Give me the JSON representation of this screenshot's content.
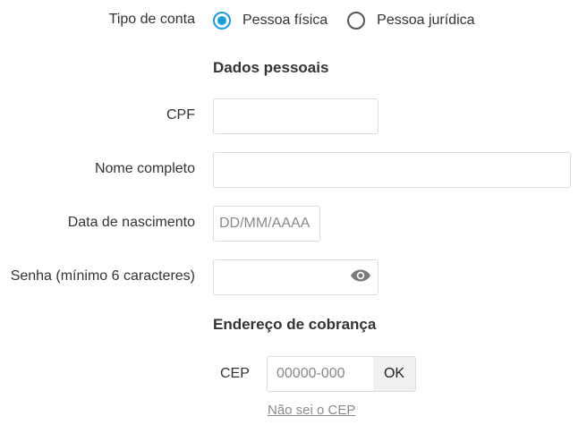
{
  "account_type": {
    "label": "Tipo de conta",
    "options": [
      {
        "label": "Pessoa física",
        "selected": true
      },
      {
        "label": "Pessoa jurídica",
        "selected": false
      }
    ]
  },
  "personal": {
    "section_title": "Dados pessoais",
    "cpf": {
      "label": "CPF",
      "value": "",
      "placeholder": ""
    },
    "full_name": {
      "label": "Nome completo",
      "value": "",
      "placeholder": ""
    },
    "birth_date": {
      "label": "Data de nascimento",
      "value": "",
      "placeholder": "DD/MM/AAAA"
    },
    "password": {
      "label": "Senha (mínimo 6 caracteres)",
      "value": "",
      "placeholder": "",
      "toggle_icon": "eye-icon"
    }
  },
  "billing": {
    "section_title": "Endereço de cobrança",
    "cep": {
      "label": "CEP",
      "value": "",
      "placeholder": "00000-000"
    },
    "ok_label": "OK",
    "unknown_cep_link": "Não sei o CEP"
  },
  "colors": {
    "accent": "#1a9ddb",
    "text": "#333333",
    "muted": "#8a8a8a",
    "border": "#dcdcdc"
  }
}
